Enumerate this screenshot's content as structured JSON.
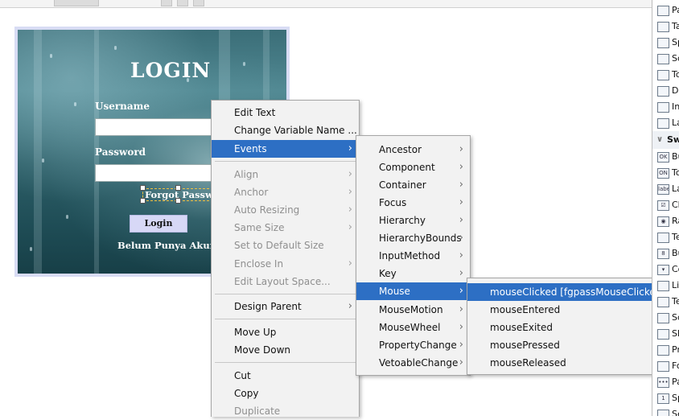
{
  "design": {
    "title": "LOGIN",
    "username_label": "Username",
    "password_label": "Password",
    "forgot_label": "Forgot Password",
    "login_button": "Login",
    "no_account_label": "Belum Punya Akun?"
  },
  "context_menu": {
    "items": [
      {
        "label": "Edit Text",
        "enabled": true
      },
      {
        "label": "Change Variable Name ...",
        "enabled": true
      },
      {
        "label": "Events",
        "enabled": true,
        "submenu": true,
        "selected": true
      },
      {
        "label": "Align",
        "enabled": false,
        "submenu": true
      },
      {
        "label": "Anchor",
        "enabled": false,
        "submenu": true
      },
      {
        "label": "Auto Resizing",
        "enabled": false,
        "submenu": true
      },
      {
        "label": "Same Size",
        "enabled": false,
        "submenu": true
      },
      {
        "label": "Set to Default Size",
        "enabled": false
      },
      {
        "label": "Enclose In",
        "enabled": false,
        "submenu": true
      },
      {
        "label": "Edit Layout Space...",
        "enabled": false
      },
      {
        "label": "Design Parent",
        "enabled": true,
        "submenu": true
      },
      {
        "label": "Move Up",
        "enabled": true
      },
      {
        "label": "Move Down",
        "enabled": true
      },
      {
        "label": "Cut",
        "enabled": true
      },
      {
        "label": "Copy",
        "enabled": true
      },
      {
        "label": "Duplicate",
        "enabled": false
      }
    ]
  },
  "events_menu": {
    "items": [
      {
        "label": "Ancestor"
      },
      {
        "label": "Component"
      },
      {
        "label": "Container"
      },
      {
        "label": "Focus"
      },
      {
        "label": "Hierarchy"
      },
      {
        "label": "HierarchyBounds"
      },
      {
        "label": "InputMethod"
      },
      {
        "label": "Key"
      },
      {
        "label": "Mouse",
        "selected": true
      },
      {
        "label": "MouseMotion"
      },
      {
        "label": "MouseWheel"
      },
      {
        "label": "PropertyChange"
      },
      {
        "label": "VetoableChange"
      }
    ]
  },
  "mouse_menu": {
    "items": [
      {
        "label": "mouseClicked [fgpassMouseClicked]",
        "selected": true
      },
      {
        "label": "mouseEntered"
      },
      {
        "label": "mouseExited"
      },
      {
        "label": "mousePressed"
      },
      {
        "label": "mouseReleased"
      }
    ]
  },
  "palette": {
    "items": [
      {
        "label": "Pa",
        "icon": "panel-icon"
      },
      {
        "label": "Ta",
        "icon": "tabbed-pane-icon"
      },
      {
        "label": "Sp",
        "icon": "split-pane-icon"
      },
      {
        "label": "Sc",
        "icon": "scroll-pane-icon"
      },
      {
        "label": "To",
        "icon": "toolbar-icon"
      },
      {
        "label": "De",
        "icon": "desktop-pane-icon"
      },
      {
        "label": "In",
        "icon": "internal-frame-icon"
      },
      {
        "label": "La",
        "icon": "layered-pane-icon"
      },
      {
        "label": "Sw",
        "category": true
      },
      {
        "label": "Bu",
        "icon": "button-icon",
        "glyph": "OK"
      },
      {
        "label": "To",
        "icon": "toggle-button-icon",
        "glyph": "ON"
      },
      {
        "label": "La",
        "icon": "label-icon",
        "glyph": "label"
      },
      {
        "label": "Ch",
        "icon": "checkbox-icon",
        "glyph": "☑"
      },
      {
        "label": "Ra",
        "icon": "radio-button-icon",
        "glyph": "◉"
      },
      {
        "label": "Te",
        "icon": "text-field-icon"
      },
      {
        "label": "Bu",
        "icon": "button-group-icon",
        "glyph": "8"
      },
      {
        "label": "Co",
        "icon": "combo-box-icon",
        "glyph": "▾"
      },
      {
        "label": "Li",
        "icon": "list-icon"
      },
      {
        "label": "Te",
        "icon": "text-area-icon"
      },
      {
        "label": "Sc",
        "icon": "scroll-bar-icon"
      },
      {
        "label": "Sl",
        "icon": "slider-icon"
      },
      {
        "label": "Pr",
        "icon": "progress-bar-icon"
      },
      {
        "label": "Fo",
        "icon": "formatted-field-icon"
      },
      {
        "label": "Pa",
        "icon": "password-field-icon",
        "glyph": "•••"
      },
      {
        "label": "Sp",
        "icon": "spinner-icon",
        "glyph": "1"
      },
      {
        "label": "Se",
        "icon": "separator-icon"
      }
    ]
  }
}
